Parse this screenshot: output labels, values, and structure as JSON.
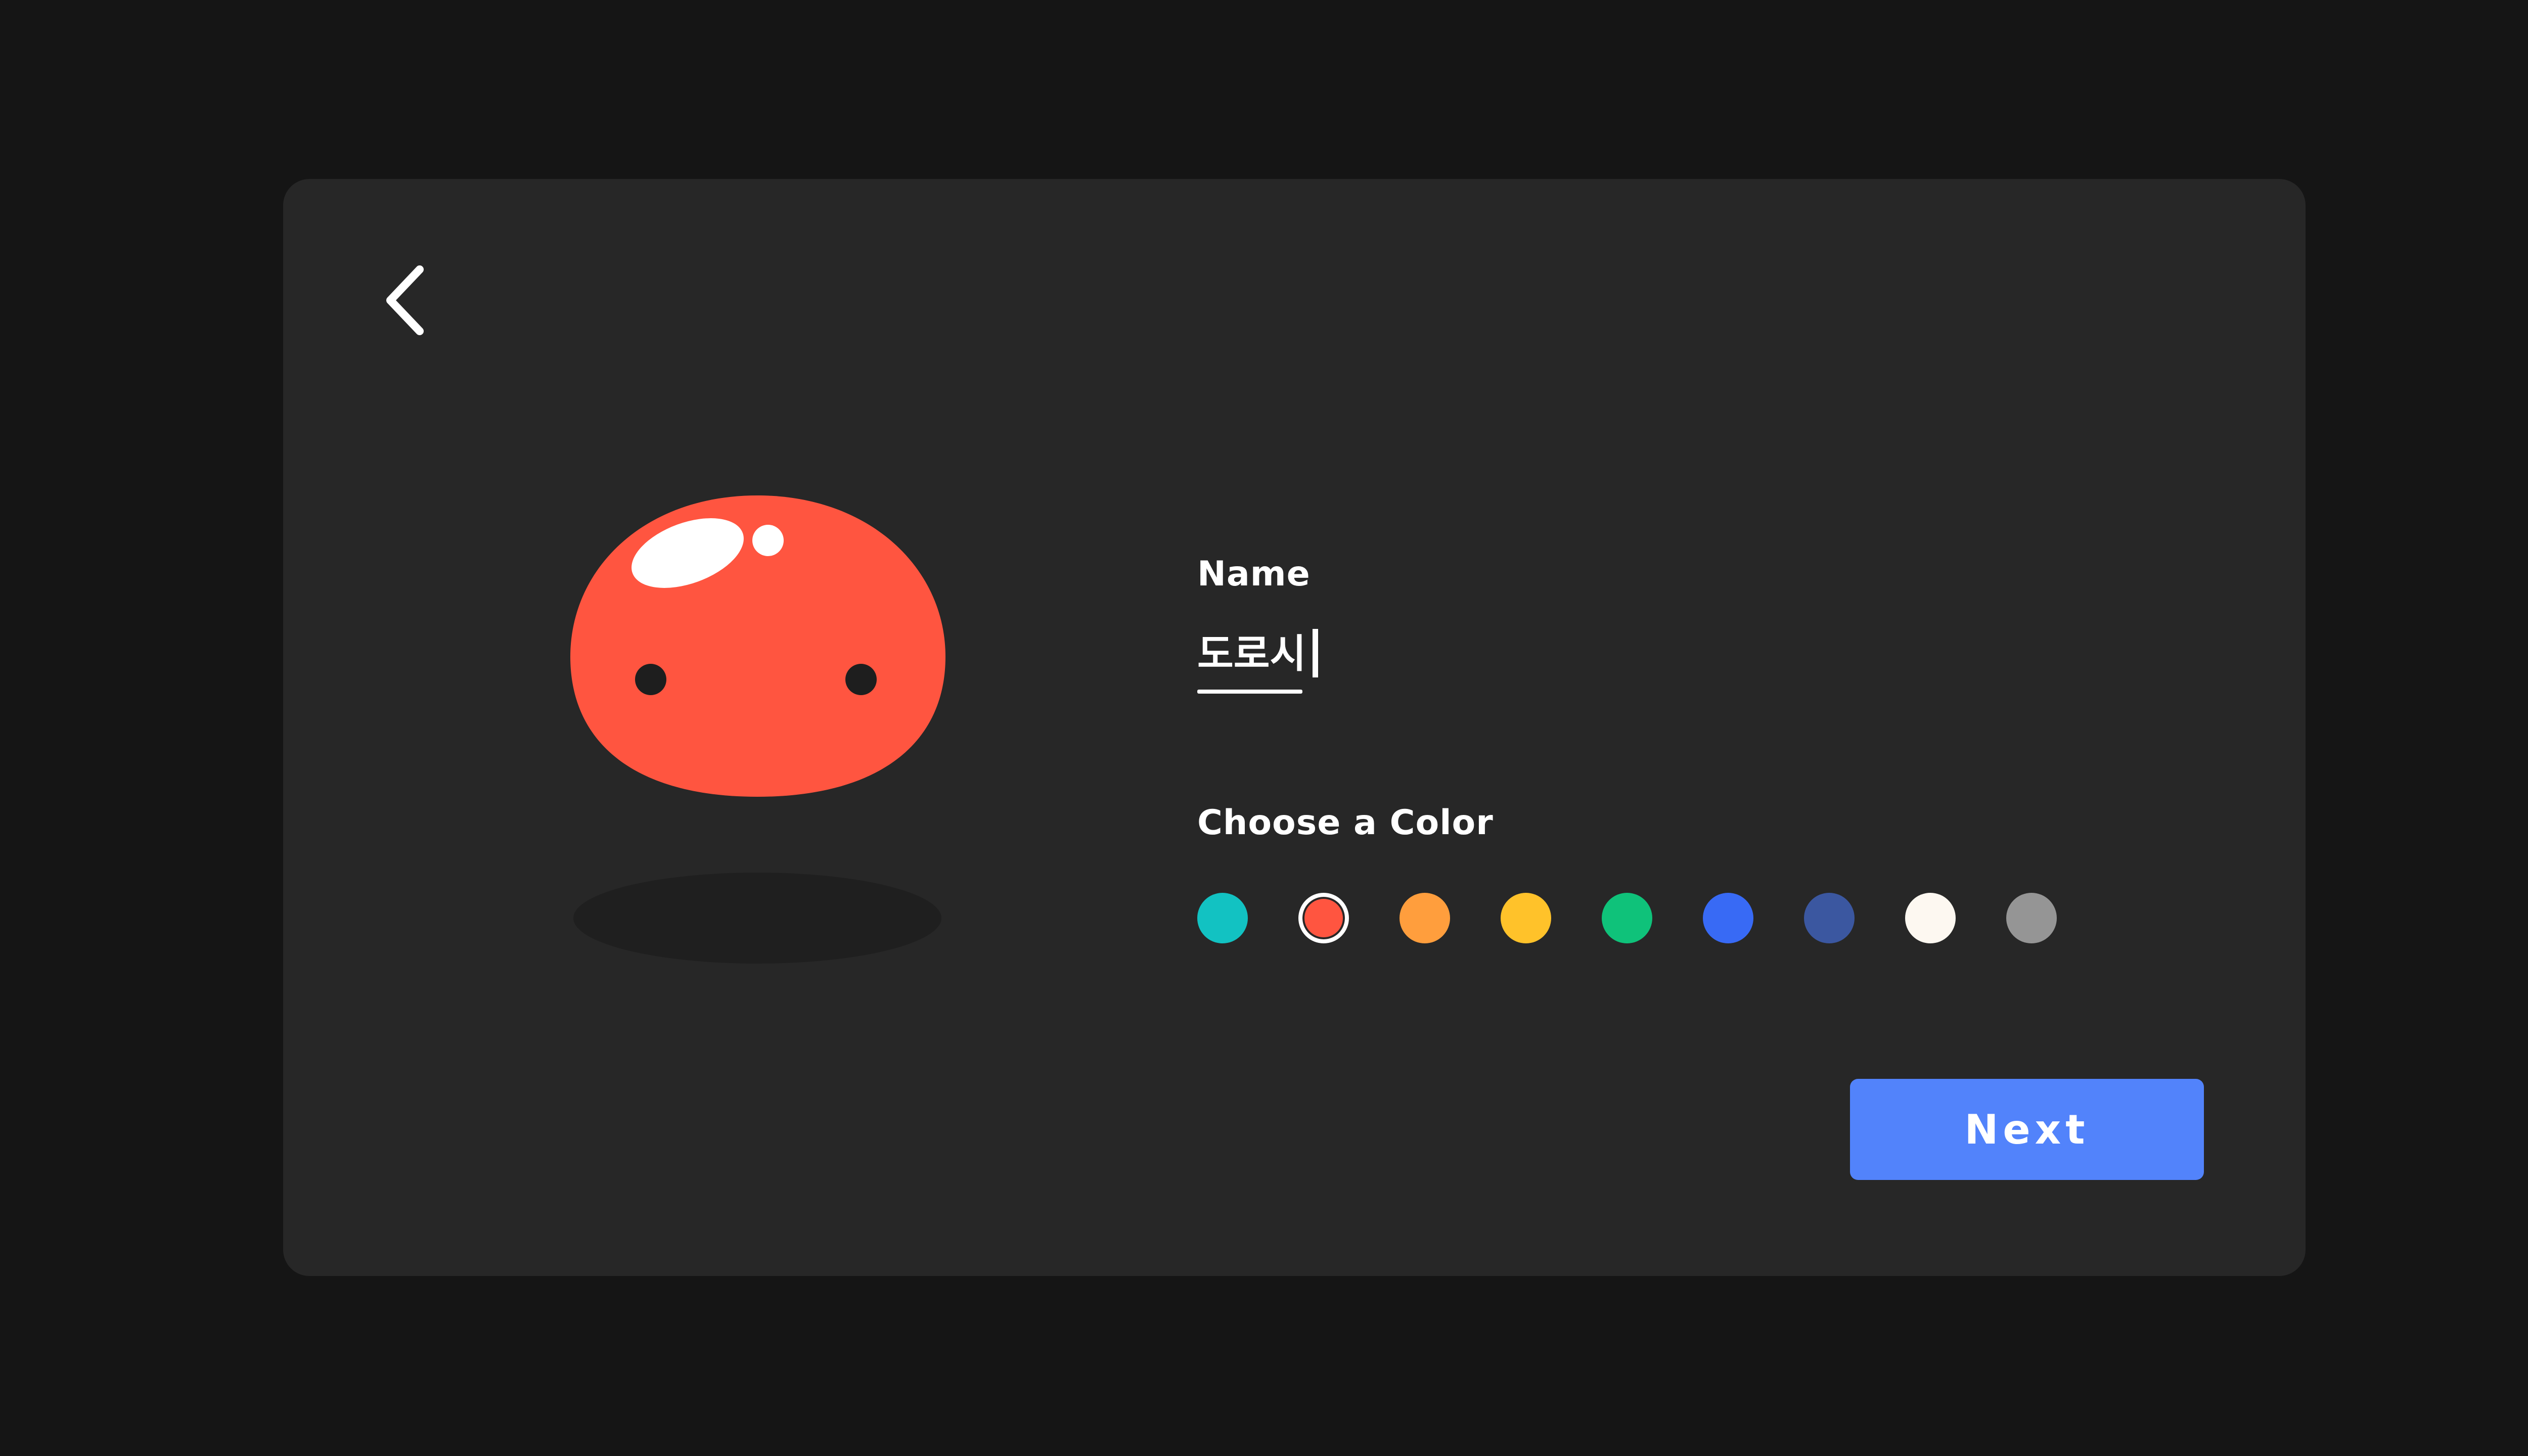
{
  "name_field": {
    "label": "Name",
    "value": "도로시"
  },
  "color_picker": {
    "label": "Choose a Color",
    "selected_index": 1,
    "options": [
      {
        "color": "#12c2c2"
      },
      {
        "color": "#ff5540"
      },
      {
        "color": "#ff9e3d"
      },
      {
        "color": "#ffc22a"
      },
      {
        "color": "#0fc27a"
      },
      {
        "color": "#386af5"
      },
      {
        "color": "#3b57a0"
      },
      {
        "color": "#fdf8f1"
      },
      {
        "color": "#959595"
      }
    ]
  },
  "actions": {
    "next_label": "Next"
  },
  "mascot": {
    "body_color": "#ff5540",
    "shadow_color": "#1f1f1f"
  },
  "icons": {
    "back": "chevron-left-icon"
  }
}
